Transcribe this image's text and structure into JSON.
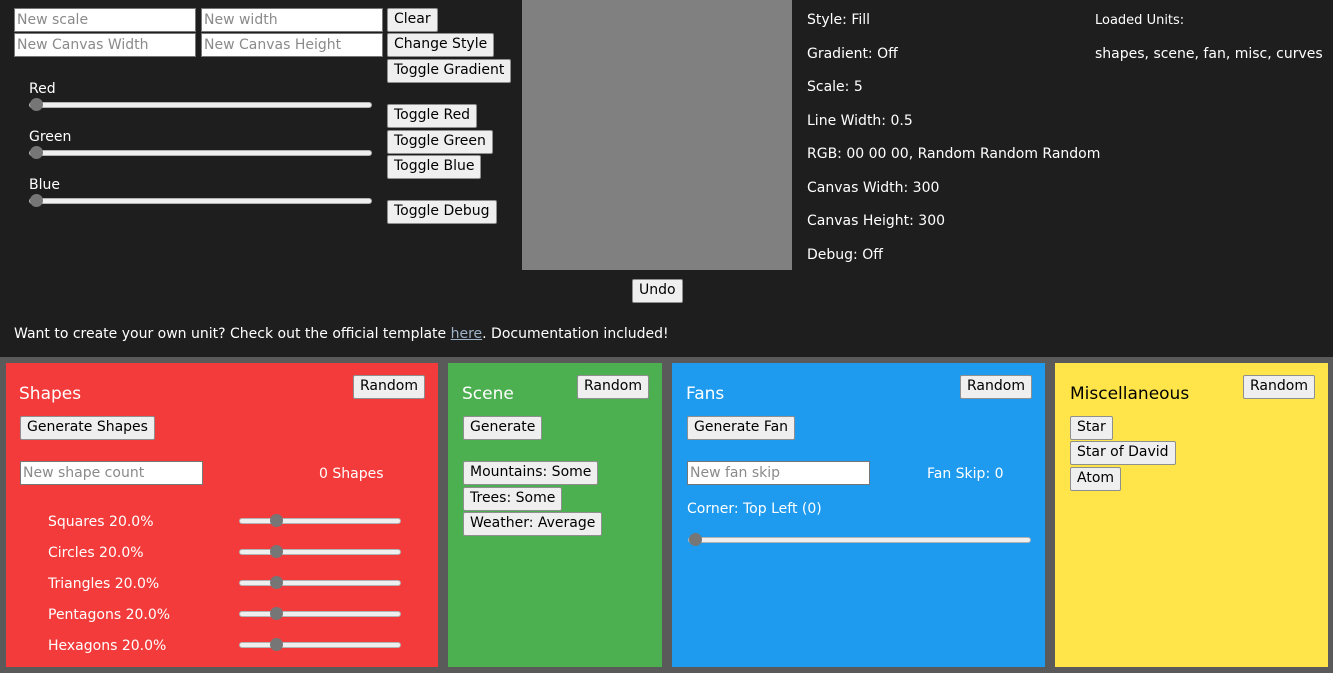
{
  "controls": {
    "scale_placeholder": "New scale",
    "width_placeholder": "New width",
    "canvas_width_placeholder": "New Canvas Width",
    "canvas_height_placeholder": "New Canvas Height",
    "clear_label": "Clear",
    "change_style_label": "Change Style",
    "toggle_gradient_label": "Toggle Gradient",
    "toggle_red_label": "Toggle Red",
    "toggle_green_label": "Toggle Green",
    "toggle_blue_label": "Toggle Blue",
    "toggle_debug_label": "Toggle Debug",
    "undo_label": "Undo"
  },
  "sliders": {
    "red_label": "Red",
    "green_label": "Green",
    "blue_label": "Blue",
    "red_value": 0,
    "green_value": 0,
    "blue_value": 0
  },
  "info": {
    "style": "Style: Fill",
    "gradient": "Gradient: Off",
    "scale": "Scale: 5",
    "line_width": "Line Width: 0.5",
    "rgb": "RGB: 00 00 00, Random Random Random",
    "canvas_width": "Canvas Width: 300",
    "canvas_height": "Canvas Height: 300",
    "debug": "Debug: Off",
    "loaded_units_title": "Loaded Units:",
    "loaded_units": "shapes, scene, fan, misc, curves"
  },
  "template_note": {
    "before": "Want to create your own unit? Check out the official template ",
    "link": "here",
    "after": ". Documentation included!"
  },
  "shapes": {
    "title": "Shapes",
    "random_label": "Random",
    "generate_label": "Generate Shapes",
    "count_placeholder": "New shape count",
    "count_text": "0 Shapes",
    "items": [
      {
        "label": "Squares 20.0%",
        "value": 0.2
      },
      {
        "label": "Circles 20.0%",
        "value": 0.2
      },
      {
        "label": "Triangles 20.0%",
        "value": 0.2
      },
      {
        "label": "Pentagons 20.0%",
        "value": 0.2
      },
      {
        "label": "Hexagons 20.0%",
        "value": 0.2
      }
    ]
  },
  "scene": {
    "title": "Scene",
    "random_label": "Random",
    "generate_label": "Generate",
    "mountains_label": "Mountains: Some",
    "trees_label": "Trees: Some",
    "weather_label": "Weather: Average"
  },
  "fans": {
    "title": "Fans",
    "random_label": "Random",
    "generate_label": "Generate Fan",
    "skip_placeholder": "New fan skip",
    "skip_text": "Fan Skip: 0",
    "corner_text": "Corner: Top Left (0)",
    "corner_value": 0
  },
  "misc": {
    "title": "Miscellaneous",
    "random_label": "Random",
    "star_label": "Star",
    "star_of_david_label": "Star of David",
    "atom_label": "Atom"
  },
  "colors": {
    "shapes_panel": "#f33b3b",
    "scene_panel": "#4caf50",
    "fans_panel": "#1e9bef",
    "misc_panel": "#ffe54a",
    "background": "#1e1e1e"
  }
}
